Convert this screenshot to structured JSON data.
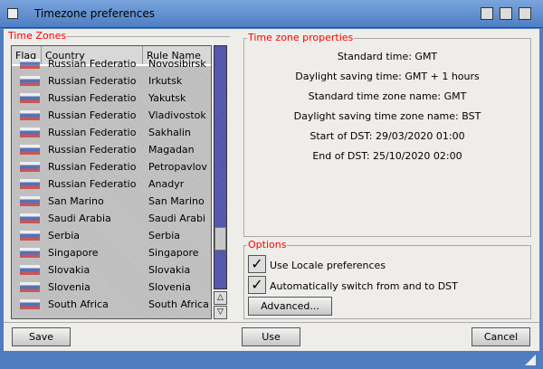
{
  "window": {
    "title": "Timezone preferences"
  },
  "timezones": {
    "label": "Time Zones",
    "columns": [
      "Flag",
      "Country",
      "Rule Name"
    ],
    "rows": [
      {
        "country": "Russian Federatio",
        "rule": "Novosibirsk"
      },
      {
        "country": "Russian Federatio",
        "rule": "Irkutsk"
      },
      {
        "country": "Russian Federatio",
        "rule": "Yakutsk"
      },
      {
        "country": "Russian Federatio",
        "rule": "Vladivostok"
      },
      {
        "country": "Russian Federatio",
        "rule": "Sakhalin"
      },
      {
        "country": "Russian Federatio",
        "rule": "Magadan"
      },
      {
        "country": "Russian Federatio",
        "rule": "Petropavlov"
      },
      {
        "country": "Russian Federatio",
        "rule": "Anadyr"
      },
      {
        "country": "San Marino",
        "rule": "San Marino"
      },
      {
        "country": "Saudi Arabia",
        "rule": "Saudi Arabi"
      },
      {
        "country": "Serbia",
        "rule": "Serbia"
      },
      {
        "country": "Singapore",
        "rule": "Singapore"
      },
      {
        "country": "Slovakia",
        "rule": "Slovakia"
      },
      {
        "country": "Slovenia",
        "rule": "Slovenia"
      },
      {
        "country": "South Africa",
        "rule": "South Africa"
      }
    ]
  },
  "properties": {
    "label": "Time zone properties",
    "lines": [
      "Standard time: GMT",
      "Daylight saving time: GMT + 1 hours",
      "Standard time zone name: GMT",
      "Daylight saving time zone name: BST",
      "Start of DST: 29/03/2020 01:00",
      "End of DST: 25/10/2020 02:00"
    ]
  },
  "options": {
    "label": "Options",
    "use_locale": "Use Locale preferences",
    "use_locale_checked": true,
    "auto_dst": "Automatically switch from and to DST",
    "auto_dst_checked": true,
    "advanced": "Advanced..."
  },
  "buttons": {
    "save": "Save",
    "use": "Use",
    "cancel": "Cancel"
  }
}
